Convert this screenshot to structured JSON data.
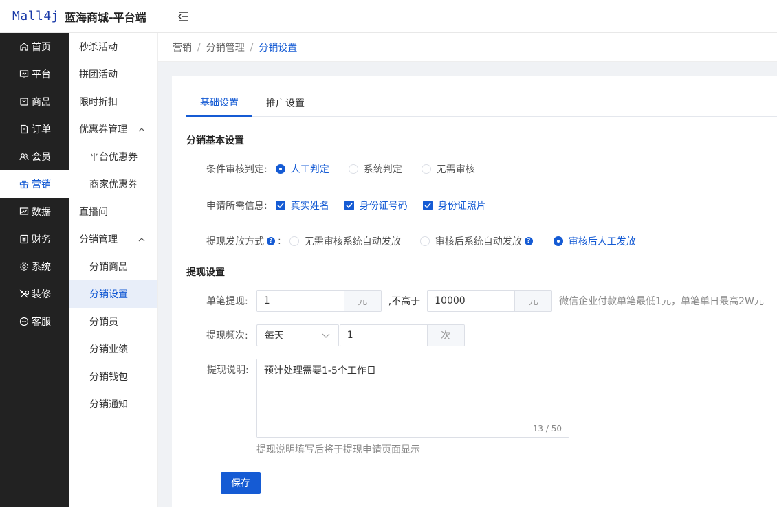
{
  "header": {
    "logo": "Mall4j",
    "title": "蓝海商城-平台端",
    "collapse_icon": "menu-fold-icon"
  },
  "sidebar": {
    "items": [
      {
        "label": "首页",
        "icon": "home-icon"
      },
      {
        "label": "平台",
        "icon": "monitor-icon"
      },
      {
        "label": "商品",
        "icon": "bag-icon"
      },
      {
        "label": "订单",
        "icon": "document-icon"
      },
      {
        "label": "会员",
        "icon": "users-icon"
      },
      {
        "label": "营销",
        "icon": "gift-icon",
        "active": true
      },
      {
        "label": "数据",
        "icon": "chart-icon"
      },
      {
        "label": "财务",
        "icon": "finance-icon"
      },
      {
        "label": "系统",
        "icon": "gear-icon"
      },
      {
        "label": "装修",
        "icon": "tools-icon"
      },
      {
        "label": "客服",
        "icon": "chat-icon"
      }
    ]
  },
  "subsidebar": {
    "items": [
      {
        "label": "秒杀活动"
      },
      {
        "label": "拼团活动"
      },
      {
        "label": "限时折扣"
      },
      {
        "label": "优惠券管理",
        "group": true
      },
      {
        "label": "平台优惠券",
        "child": true
      },
      {
        "label": "商家优惠券",
        "child": true
      },
      {
        "label": "直播间"
      },
      {
        "label": "分销管理",
        "group": true
      },
      {
        "label": "分销商品",
        "child": true
      },
      {
        "label": "分销设置",
        "child": true,
        "active": true
      },
      {
        "label": "分销员",
        "child": true
      },
      {
        "label": "分销业绩",
        "child": true
      },
      {
        "label": "分销钱包",
        "child": true
      },
      {
        "label": "分销通知",
        "child": true
      }
    ]
  },
  "breadcrumb": [
    "营销",
    "分销管理",
    "分销设置"
  ],
  "tabs": [
    {
      "label": "基础设置",
      "active": true
    },
    {
      "label": "推广设置"
    }
  ],
  "basic": {
    "title": "分销基本设置",
    "audit": {
      "label": "条件审核判定:",
      "options": [
        "人工判定",
        "系统判定",
        "无需审核"
      ],
      "selected": 0
    },
    "info": {
      "label": "申请所需信息:",
      "options": [
        "真实姓名",
        "身份证号码",
        "身份证照片"
      ]
    },
    "payout": {
      "label": "提现发放方式",
      "colon": ":",
      "options": [
        "无需审核系统自动发放",
        "审核后系统自动发放",
        "审核后人工发放"
      ],
      "selected": 2
    }
  },
  "withdraw": {
    "title": "提现设置",
    "single": {
      "label": "单笔提现:",
      "min": "1",
      "unit": "元",
      "mid": ",不高于",
      "max": "10000",
      "unit2": "元",
      "hint": "微信企业付款单笔最低1元，单笔单日最高2W元"
    },
    "freq": {
      "label": "提现频次:",
      "period": "每天",
      "count": "1",
      "unit": "次"
    },
    "desc": {
      "label": "提现说明:",
      "value": "预计处理需要1-5个工作日",
      "counter": "13 / 50",
      "hint": "提现说明填写后将于提现申请页面显示"
    }
  },
  "save_label": "保存"
}
